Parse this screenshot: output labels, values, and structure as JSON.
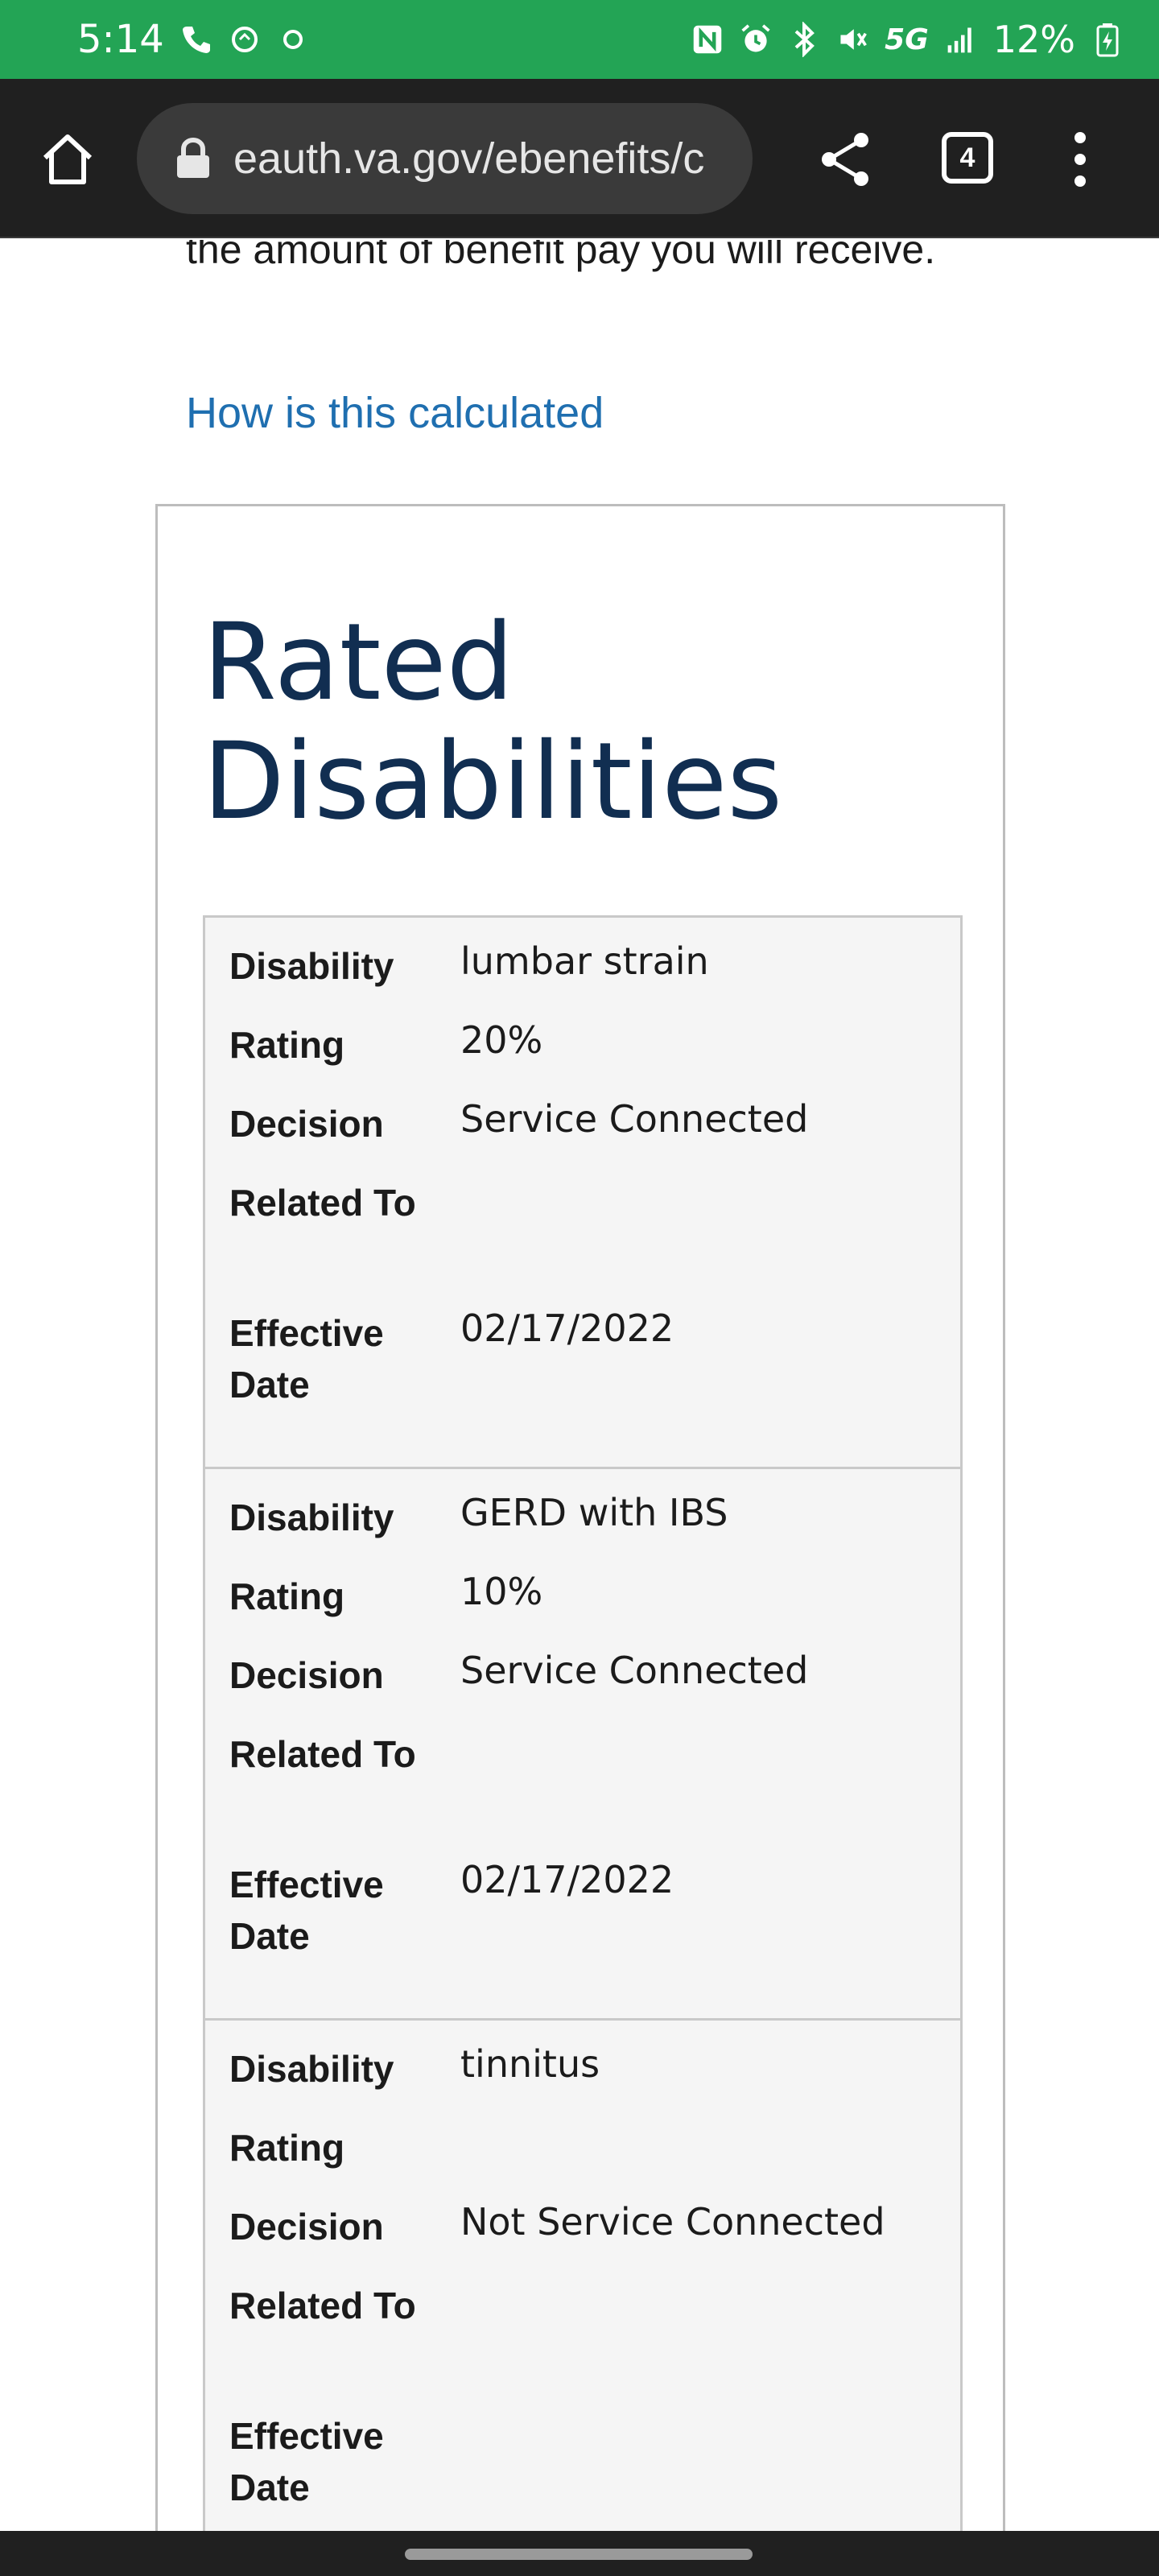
{
  "status_bar": {
    "time": "5:14",
    "battery": "12%",
    "network": "5G",
    "icons": [
      "call-icon",
      "sync-icon",
      "circle-icon",
      "nfc-icon",
      "alarm-icon",
      "bluetooth-icon",
      "mute-icon",
      "signal-icon",
      "battery-icon"
    ]
  },
  "browser": {
    "url": "eauth.va.gov/ebenefits/c",
    "tab_count": "4"
  },
  "page": {
    "intro_text": "the amount of benefit pay you will receive.",
    "calc_link": "How is this calculated",
    "section_title": "Rated Disabilities",
    "labels": {
      "disability": "Disability",
      "rating": "Rating",
      "decision": "Decision",
      "related_to": "Related To",
      "effective_date": "Effective Date"
    },
    "disabilities": [
      {
        "disability": "lumbar strain",
        "rating": "20%",
        "decision": "Service Connected",
        "related_to": "",
        "effective_date": "02/17/2022"
      },
      {
        "disability": "GERD with IBS",
        "rating": "10%",
        "decision": "Service Connected",
        "related_to": "",
        "effective_date": "02/17/2022"
      },
      {
        "disability": "tinnitus",
        "rating": "",
        "decision": "Not Service Connected",
        "related_to": "",
        "effective_date": ""
      }
    ]
  },
  "colors": {
    "status_bar": "#23a455",
    "browser_bar": "#202020",
    "link": "#1f6fb0",
    "title": "#112e51"
  }
}
